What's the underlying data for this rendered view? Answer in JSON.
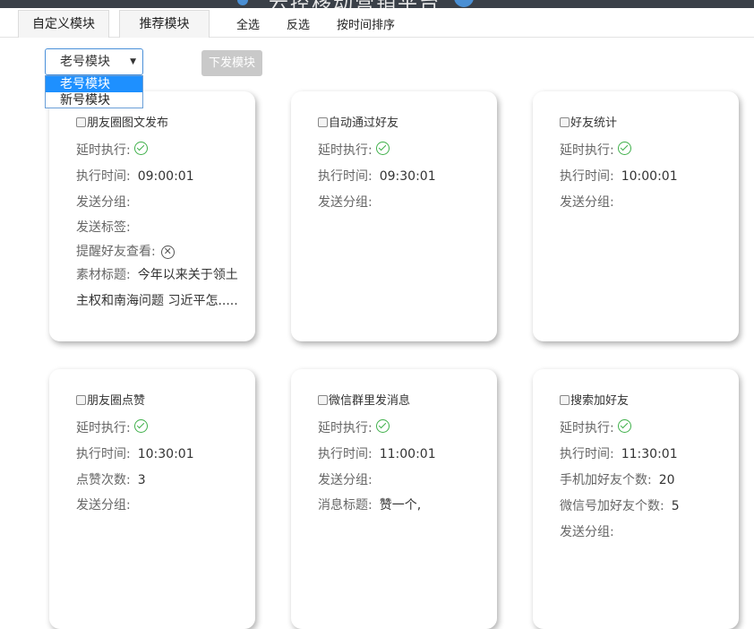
{
  "header": {
    "title": "云控移动营销平台"
  },
  "tabs": {
    "custom": "自定义模块",
    "recommend": "推荐模块"
  },
  "actions": {
    "select_all": "全选",
    "invert": "反选",
    "sort_time": "按时间排序"
  },
  "module_select": {
    "value": "老号模块",
    "options": [
      "老号模块",
      "新号模块"
    ],
    "highlighted": "老号模块"
  },
  "send_button": "下发模块",
  "labels": {
    "delay": "延时执行:",
    "time": "执行时间:",
    "group": "发送分组:",
    "tag": "发送标签:",
    "remind": "提醒好友查看:",
    "material": "素材标题:",
    "likes": "点赞次数:",
    "msg": "消息标题:",
    "phone_add": "手机加好友个数:",
    "wx_add": "微信号加好友个数:"
  },
  "cards": [
    {
      "title": "朋友圈图文发布",
      "delay": true,
      "time": "09:00:01",
      "remind": false,
      "material_line1": "今年以来关于领土",
      "material_line2": "主权和南海问题 习近平怎....."
    },
    {
      "title": "自动通过好友",
      "delay": true,
      "time": "09:30:01"
    },
    {
      "title": "好友统计",
      "delay": true,
      "time": "10:00:01"
    },
    {
      "title": "朋友圈点赞",
      "delay": true,
      "time": "10:30:01",
      "likes": "3"
    },
    {
      "title": "微信群里发消息",
      "delay": true,
      "time": "11:00:01",
      "msg": "赞一个,"
    },
    {
      "title": "搜索加好友",
      "delay": true,
      "time": "11:30:01",
      "phone_add": "20",
      "wx_add": "5"
    }
  ],
  "colors": {
    "accent": "#1e90ff",
    "check": "#3fb04a",
    "disabled_button": "#c9c9c9"
  }
}
